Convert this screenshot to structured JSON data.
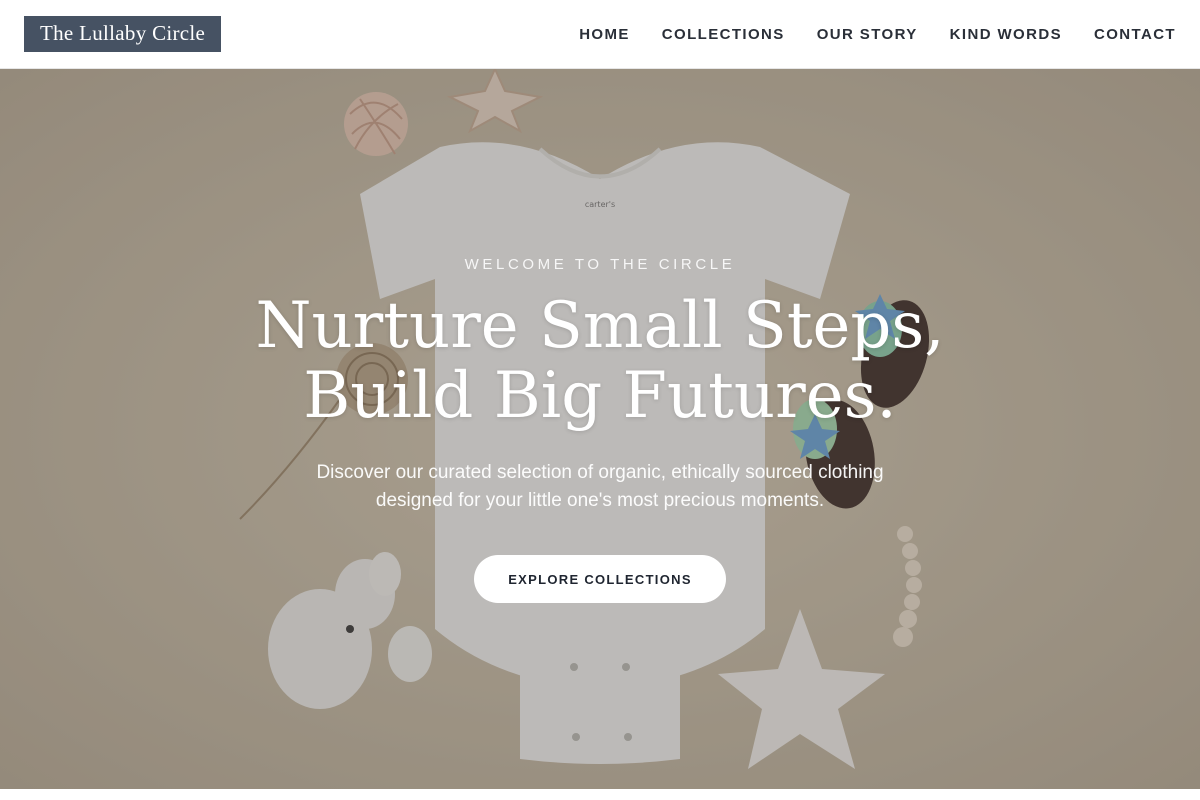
{
  "header": {
    "logo": "The Lullaby Circle",
    "nav": [
      {
        "label": "HOME"
      },
      {
        "label": "COLLECTIONS"
      },
      {
        "label": "OUR STORY"
      },
      {
        "label": "KIND WORDS"
      },
      {
        "label": "CONTACT"
      }
    ]
  },
  "hero": {
    "eyebrow": "WELCOME TO THE CIRCLE",
    "headline_line1": "Nurture Small Steps,",
    "headline_line2": "Build Big Futures.",
    "subtext_line1": "Discover our curated selection of organic, ethically sourced clothing",
    "subtext_line2": "designed for your little one's most precious moments.",
    "cta_label": "EXPLORE COLLECTIONS",
    "onesie_tag": "carter's"
  },
  "colors": {
    "logo_bg": "#465263",
    "nav_text": "#2a2f38",
    "hero_bg": "#c9bda6",
    "cta_bg": "#ffffff"
  }
}
